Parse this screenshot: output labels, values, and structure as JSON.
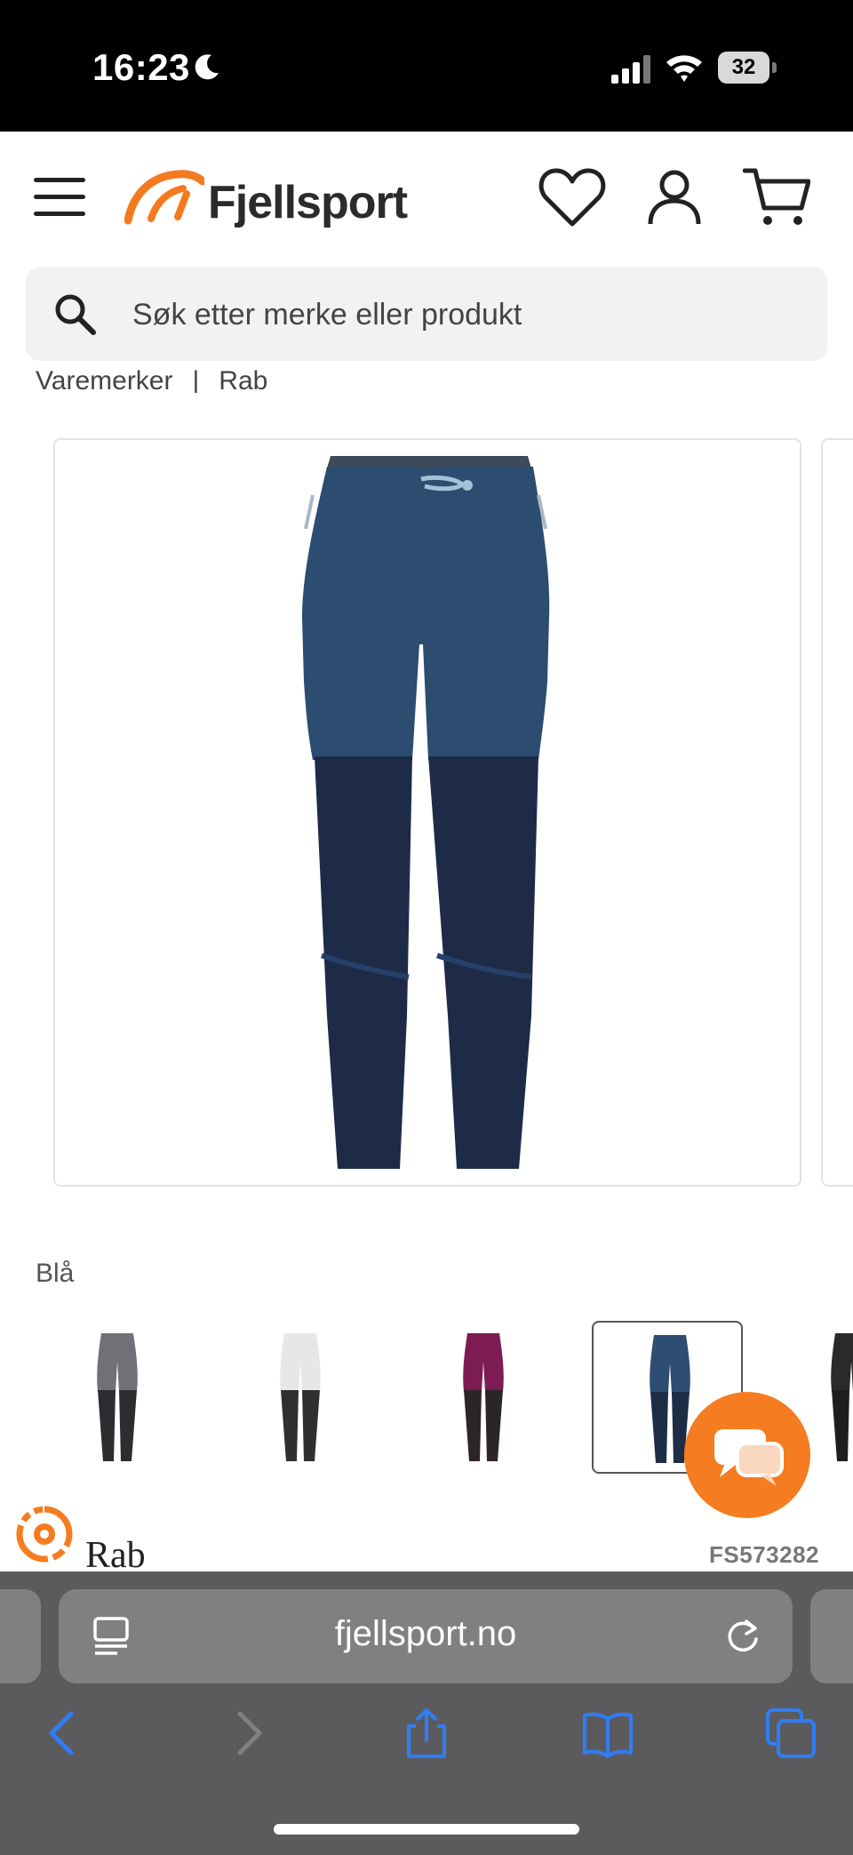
{
  "status_bar": {
    "time": "16:23",
    "battery": "32"
  },
  "header": {
    "logo_text": "Fjellsport"
  },
  "search": {
    "placeholder": "Søk etter merke eller produkt"
  },
  "breadcrumb": [
    "Varemerker",
    "Rab"
  ],
  "product": {
    "main_image": "navy-two-tone-hiking-pants",
    "selected_color": "Blå",
    "color_variants": [
      {
        "name": "grey-black-pants",
        "top_color": "#6f7176",
        "bottom_color": "#2c2d30",
        "selected": false
      },
      {
        "name": "white-black-pants",
        "top_color": "#e7e8e6",
        "bottom_color": "#2e2f31",
        "selected": false
      },
      {
        "name": "purple-black-pants",
        "top_color": "#7d1c52",
        "bottom_color": "#2c2528",
        "selected": false
      },
      {
        "name": "blue-navy-pants",
        "top_color": "#2e4d72",
        "bottom_color": "#1d2d45",
        "selected": true
      },
      {
        "name": "black-pants",
        "top_color": "#2a2a2c",
        "bottom_color": "#1e1e20",
        "selected": false
      }
    ],
    "brand": "Rab",
    "sku": "FS573282"
  },
  "browser": {
    "url": "fjellsport.no"
  },
  "colors": {
    "accent": "#f57c20",
    "ios_blue": "#2f7df6"
  }
}
